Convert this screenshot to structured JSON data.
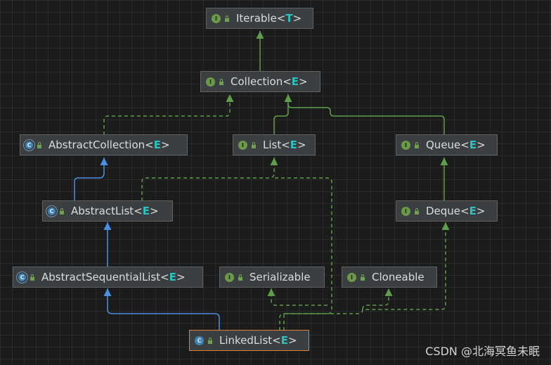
{
  "nodes": {
    "iterable": {
      "name": "Iterable<",
      "param": "T",
      "close": ">",
      "kind": "I"
    },
    "collection": {
      "name": "Collection<",
      "param": "E",
      "close": ">",
      "kind": "I"
    },
    "abstract_collection": {
      "name": "AbstractCollection<",
      "param": "E",
      "close": ">",
      "kind": "C"
    },
    "list": {
      "name": "List<",
      "param": "E",
      "close": ">",
      "kind": "I"
    },
    "queue": {
      "name": "Queue<",
      "param": "E",
      "close": ">",
      "kind": "I"
    },
    "abstract_list": {
      "name": "AbstractList<",
      "param": "E",
      "close": ">",
      "kind": "C"
    },
    "deque": {
      "name": "Deque<",
      "param": "E",
      "close": ">",
      "kind": "I"
    },
    "abstract_sequential_list": {
      "name": "AbstractSequentialList<",
      "param": "E",
      "close": ">",
      "kind": "C"
    },
    "serializable": {
      "name": "Serializable",
      "kind": "I"
    },
    "cloneable": {
      "name": "Cloneable",
      "kind": "I"
    },
    "linked_list": {
      "name": "LinkedList<",
      "param": "E",
      "close": ">",
      "kind": "C"
    }
  },
  "colors": {
    "extends_interface": "#5f9d4a",
    "extends_class": "#4a8fe0",
    "implements": "#5f9d4a",
    "selected_border": "#d9823b"
  },
  "watermark": "CSDN @北海冥鱼未眠"
}
